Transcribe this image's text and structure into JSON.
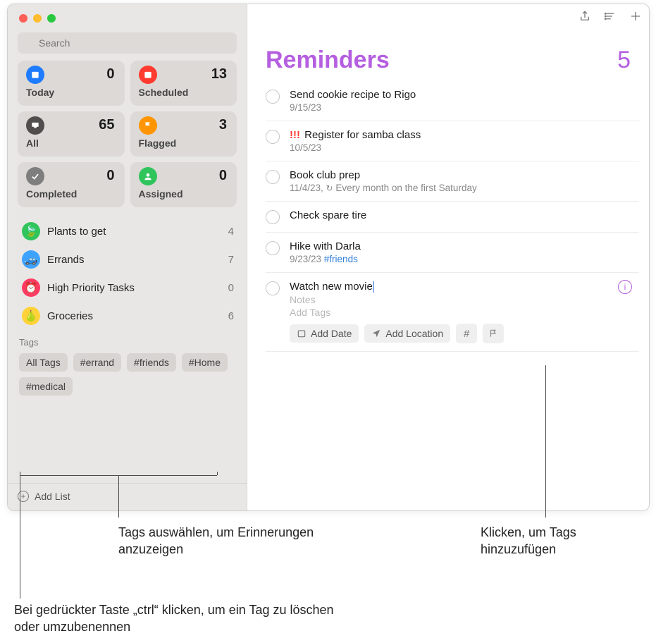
{
  "search": {
    "placeholder": "Search"
  },
  "smart_lists": [
    {
      "label": "Today",
      "count": "0"
    },
    {
      "label": "Scheduled",
      "count": "13"
    },
    {
      "label": "All",
      "count": "65"
    },
    {
      "label": "Flagged",
      "count": "3"
    },
    {
      "label": "Completed",
      "count": "0"
    },
    {
      "label": "Assigned",
      "count": "0"
    }
  ],
  "lists": [
    {
      "name": "Plants to get",
      "count": "4"
    },
    {
      "name": "Errands",
      "count": "7"
    },
    {
      "name": "High Priority Tasks",
      "count": "0"
    },
    {
      "name": "Groceries",
      "count": "6"
    }
  ],
  "tags_header": "Tags",
  "tags": [
    "All Tags",
    "#errand",
    "#friends",
    "#Home",
    "#medical"
  ],
  "add_list_label": "Add List",
  "main": {
    "title": "Reminders",
    "count": "5",
    "reminders": [
      {
        "title": "Send cookie recipe to Rigo",
        "sub": "9/15/23"
      },
      {
        "title_prefix": "!!!",
        "title": "Register for samba class",
        "sub": "10/5/23"
      },
      {
        "title": "Book club prep",
        "sub": "11/4/23,  Every month on the first Saturday",
        "repeats": true
      },
      {
        "title": "Check spare tire"
      },
      {
        "title": "Hike with Darla",
        "sub": "9/23/23 ",
        "tag": "#friends"
      }
    ],
    "editing": {
      "title": "Watch new movie",
      "notes_placeholder": "Notes",
      "tags_placeholder": "Add Tags",
      "add_date": "Add Date",
      "add_location": "Add Location"
    }
  },
  "annotations": {
    "tags_select": "Tags auswählen, um Erinnerungen anzuzeigen",
    "add_tags_click": "Klicken, um Tags hinzuzufügen",
    "ctrl_click": "Bei gedrückter Taste „ctrl“ klicken, um ein Tag zu löschen oder umzubenennen"
  }
}
